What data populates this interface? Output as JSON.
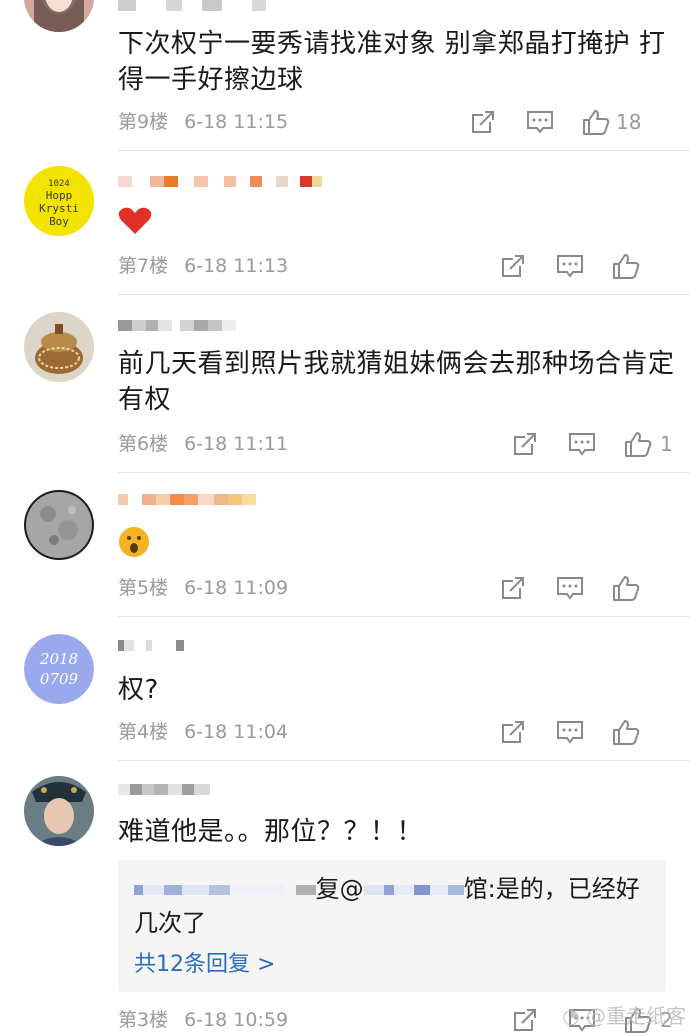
{
  "comments": [
    {
      "text": "下次权宁一要秀请找准对象 别拿郑晶打掩护 打得一手好擦边球",
      "floor": "第9楼",
      "time": "6-18 11:15",
      "likes": "18",
      "avatar_icon": "girl-photo-avatar"
    },
    {
      "text": "",
      "emoji": "❤",
      "floor": "第7楼",
      "time": "6-18 11:13",
      "likes": "",
      "avatar_lines": [
        "1024",
        "Hopp",
        "Krysti",
        "Boy"
      ],
      "avatar_color": "#f2e400"
    },
    {
      "text": "前几天看到照片我就猜姐妹俩会去那种场合肯定有权",
      "floor": "第6楼",
      "time": "6-18 11:11",
      "likes": "1",
      "avatar_icon": "jar-avatar"
    },
    {
      "text": "",
      "emoji": "😮",
      "floor": "第5楼",
      "time": "6-18 11:09",
      "likes": "",
      "avatar_icon": "moon-avatar"
    },
    {
      "text": "权?",
      "floor": "第4楼",
      "time": "6-18 11:04",
      "likes": "",
      "avatar_lines": [
        "2018",
        "0709"
      ],
      "avatar_color": "#9aa8ee"
    },
    {
      "text": "难道他是。。那位？？！！",
      "floor": "第3楼",
      "time": "6-18 10:59",
      "likes": "2",
      "avatar_icon": "costume-avatar",
      "reply": {
        "prefix": "复@",
        "text": "馆:是的，已经好几次了",
        "more": "共12条回复 >"
      }
    }
  ],
  "watermark": "@重走纸客",
  "colors": {
    "text": "#1a1a1a",
    "meta": "#9a9a9a",
    "link": "#2e6bbd",
    "divider": "#e6e6e6"
  }
}
